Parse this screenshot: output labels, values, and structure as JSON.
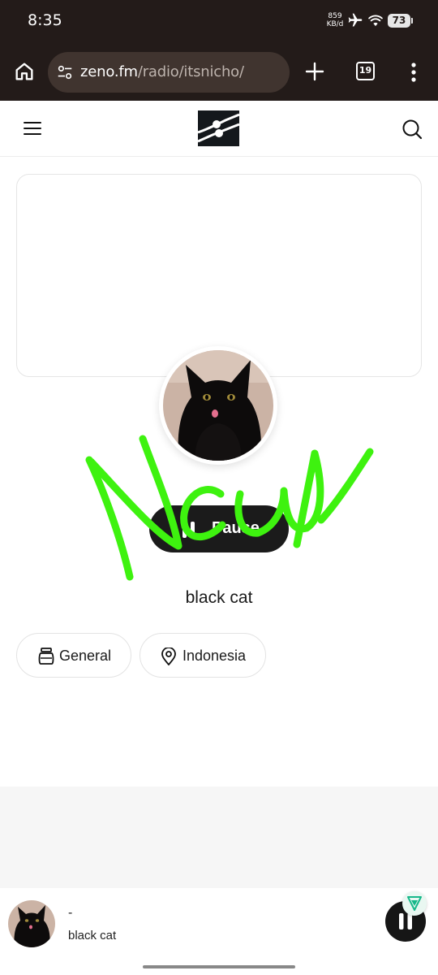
{
  "status_bar": {
    "time": "8:35",
    "net_speed_value": "859",
    "net_speed_unit": "KB/d",
    "battery": "73",
    "icons": [
      "airplane-icon",
      "wifi-icon",
      "battery-icon"
    ]
  },
  "browser": {
    "url_domain": "zeno.fm",
    "url_path": "/radio/itsnicho/",
    "tab_count": "19",
    "icons": [
      "home-icon",
      "tune-icon",
      "plus-icon",
      "more-vertical-icon"
    ]
  },
  "site_header": {
    "icons": [
      "menu-icon",
      "zeno-logo",
      "search-icon"
    ]
  },
  "player": {
    "pause_label": "Pause",
    "station_name": "black cat",
    "tags": [
      {
        "label": "General",
        "icon": "jar-icon"
      },
      {
        "label": "Indonesia",
        "icon": "location-pin-icon"
      }
    ]
  },
  "mini_player": {
    "title": "-",
    "subtitle": "black cat"
  },
  "colors": {
    "browser_chrome": "#231b19",
    "url_bar": "#40342f",
    "button_dark": "#1b1b1b",
    "handwriting": "#3ef20f"
  }
}
